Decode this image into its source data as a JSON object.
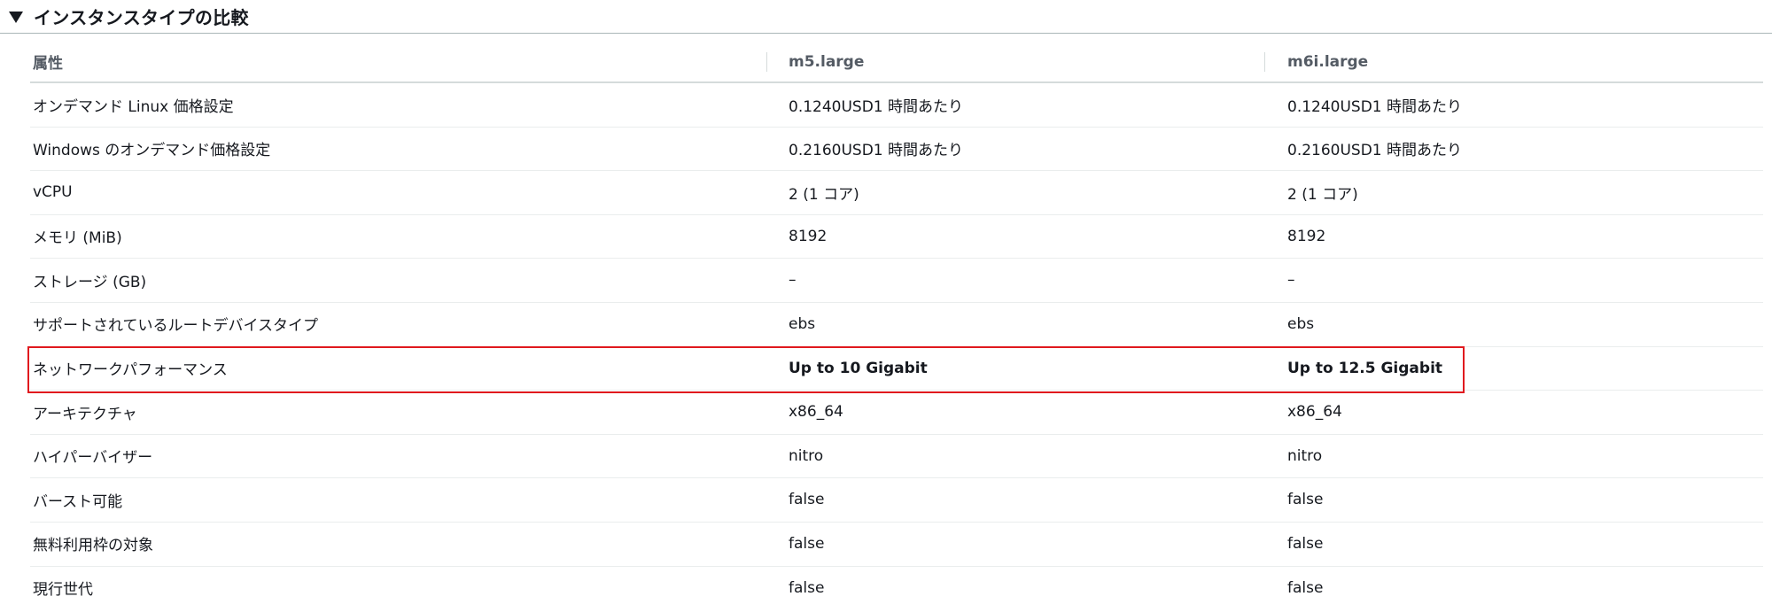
{
  "section": {
    "title": "インスタンスタイプの比較"
  },
  "table": {
    "headers": [
      "属性",
      "m5.large",
      "m6i.large"
    ],
    "rows": [
      {
        "attr": "オンデマンド Linux 価格設定",
        "a": "0.1240USD1 時間あたり",
        "b": "0.1240USD1 時間あたり"
      },
      {
        "attr": "Windows のオンデマンド価格設定",
        "a": "0.2160USD1 時間あたり",
        "b": "0.2160USD1 時間あたり"
      },
      {
        "attr": "vCPU",
        "a": "2 (1 コア)",
        "b": "2 (1 コア)"
      },
      {
        "attr": "メモリ (MiB)",
        "a": "8192",
        "b": "8192"
      },
      {
        "attr": "ストレージ (GB)",
        "a": "–",
        "b": "–"
      },
      {
        "attr": "サポートされているルートデバイスタイプ",
        "a": "ebs",
        "b": "ebs"
      },
      {
        "attr": "ネットワークパフォーマンス",
        "a": "Up to 10 Gigabit",
        "b": "Up to 12.5 Gigabit"
      },
      {
        "attr": "アーキテクチャ",
        "a": "x86_64",
        "b": "x86_64"
      },
      {
        "attr": "ハイパーバイザー",
        "a": "nitro",
        "b": "nitro"
      },
      {
        "attr": "バースト可能",
        "a": "false",
        "b": "false"
      },
      {
        "attr": "無料利用枠の対象",
        "a": "false",
        "b": "false"
      },
      {
        "attr": "現行世代",
        "a": "false",
        "b": "false"
      }
    ]
  },
  "colors": {
    "highlight": "#e0191e",
    "header_text": "#545b64",
    "body_text": "#16191f"
  }
}
